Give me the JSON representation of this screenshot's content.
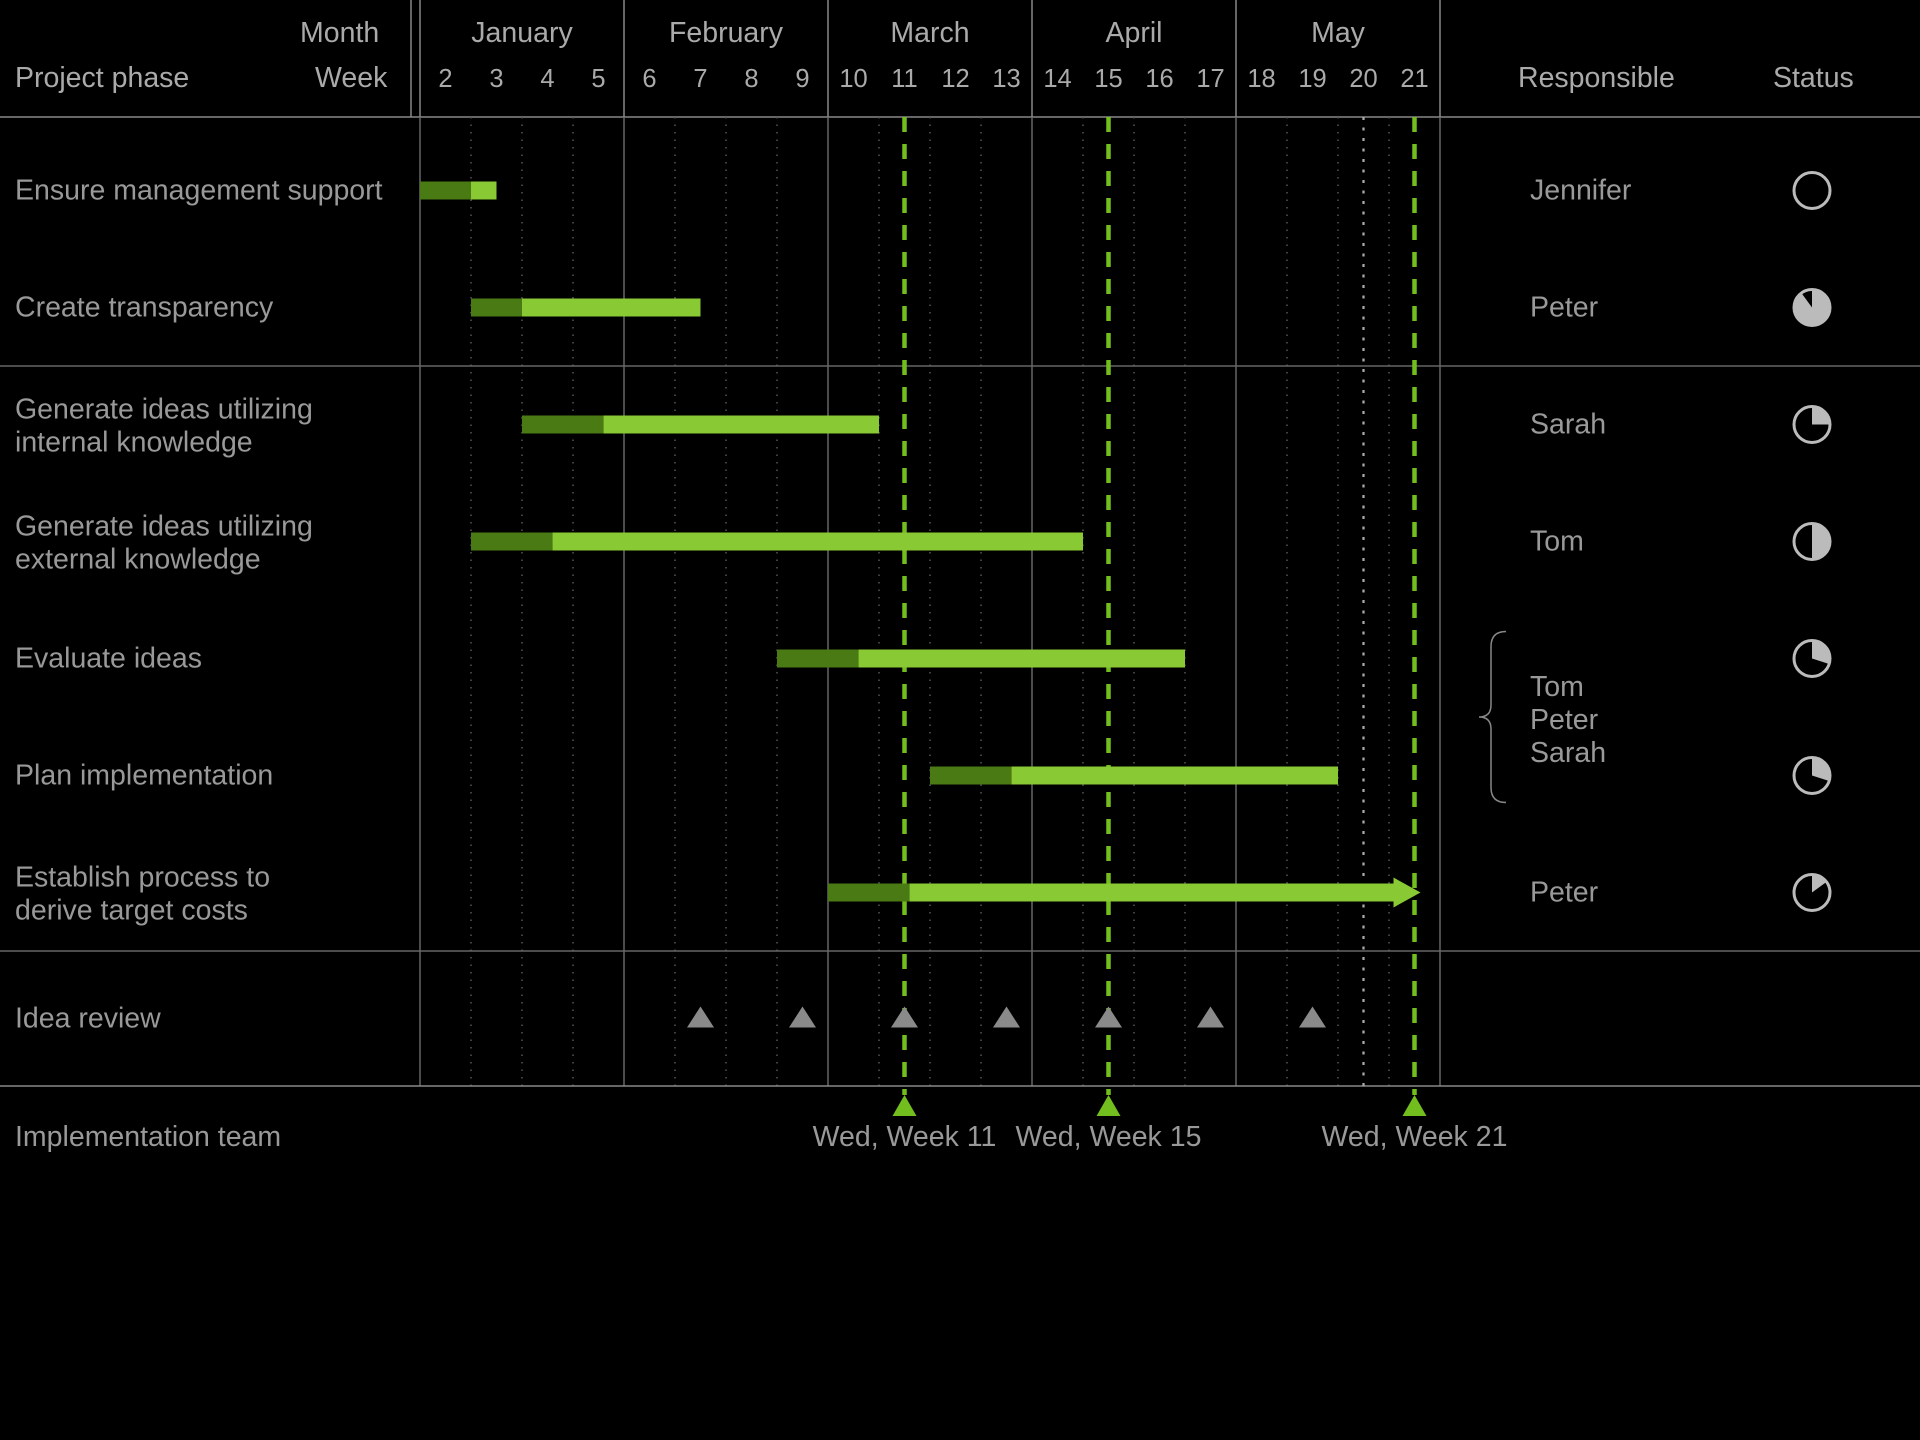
{
  "header": {
    "month_label": "Month",
    "week_label": "Week",
    "project_phase_label": "Project phase",
    "responsible_label": "Responsible",
    "status_label": "Status"
  },
  "axis": {
    "months": [
      {
        "name": "January",
        "weeks": [
          "2",
          "3",
          "4",
          "5"
        ]
      },
      {
        "name": "February",
        "weeks": [
          "6",
          "7",
          "8",
          "9"
        ]
      },
      {
        "name": "March",
        "weeks": [
          "10",
          "11",
          "12",
          "13"
        ]
      },
      {
        "name": "April",
        "weeks": [
          "14",
          "15",
          "16",
          "17"
        ]
      },
      {
        "name": "May",
        "weeks": [
          "18",
          "19",
          "20",
          "21"
        ]
      }
    ],
    "week_start": 2,
    "week_end": 21
  },
  "rows": [
    {
      "label": "Ensure management support",
      "start_week": 2,
      "end_week": 3.5,
      "arrow": false,
      "responsible": "Jennifer",
      "status_pct": 0
    },
    {
      "label": "Create transparency",
      "start_week": 3,
      "end_week": 7.5,
      "arrow": false,
      "responsible": "Peter",
      "status_pct": 90
    },
    {
      "label": "Generate ideas utilizing internal knowledge",
      "start_week": 4,
      "end_week": 11,
      "arrow": false,
      "responsible": "Sarah",
      "status_pct": 25
    },
    {
      "label": "Generate ideas utilizing external knowledge",
      "start_week": 3,
      "end_week": 15,
      "arrow": false,
      "responsible": "Tom",
      "status_pct": 50
    },
    {
      "label": "Evaluate ideas",
      "start_week": 9,
      "end_week": 17,
      "arrow": false,
      "responsible": "Tom Peter Sarah",
      "status_pct": 30
    },
    {
      "label": "Plan implementation",
      "start_week": 12,
      "end_week": 20,
      "arrow": false,
      "responsible": "Tom Peter Sarah",
      "status_pct": 30
    },
    {
      "label": "Establish process to derive target costs",
      "start_week": 10,
      "end_week": 21.5,
      "arrow": true,
      "responsible": "Peter",
      "status_pct": 15
    }
  ],
  "review_row": {
    "label": "Idea review",
    "weeks": [
      7,
      9,
      11,
      13,
      15,
      17,
      19
    ]
  },
  "milestones": {
    "label_row": "Implementation team",
    "items": [
      {
        "week": 11,
        "label": "Wed, Week 11"
      },
      {
        "week": 15,
        "label": "Wed, Week 15"
      },
      {
        "week": 21,
        "label": "Wed, Week 21"
      }
    ]
  },
  "today_week": 20.5,
  "shared_responsible_text": [
    "Tom",
    "Peter",
    "Sarah"
  ],
  "colors": {
    "bar_dark": "#4a7a14",
    "bar_light": "#89c933",
    "accent": "#72be1e",
    "marker_grey": "#8a8a8a"
  },
  "chart_data": {
    "type": "bar",
    "title": "Project phase Gantt",
    "xlabel": "Week",
    "ylabel": "Project phase",
    "categories": [
      "Ensure management support",
      "Create transparency",
      "Generate ideas utilizing internal knowledge",
      "Generate ideas utilizing external knowledge",
      "Evaluate ideas",
      "Plan implementation",
      "Establish process to derive target costs"
    ],
    "series": [
      {
        "name": "start_week",
        "values": [
          2,
          3,
          4,
          3,
          9,
          12,
          10
        ]
      },
      {
        "name": "end_week",
        "values": [
          3.5,
          7.5,
          11,
          15,
          17,
          20,
          21.5
        ]
      },
      {
        "name": "status_pct",
        "values": [
          0,
          90,
          25,
          50,
          30,
          30,
          15
        ]
      }
    ],
    "responsible": [
      "Jennifer",
      "Peter",
      "Sarah",
      "Tom",
      "Tom/Peter/Sarah",
      "Tom/Peter/Sarah",
      "Peter"
    ],
    "milestones": [
      11,
      15,
      21
    ],
    "review_markers": [
      7,
      9,
      11,
      13,
      15,
      17,
      19
    ],
    "xlim": [
      2,
      21
    ]
  }
}
